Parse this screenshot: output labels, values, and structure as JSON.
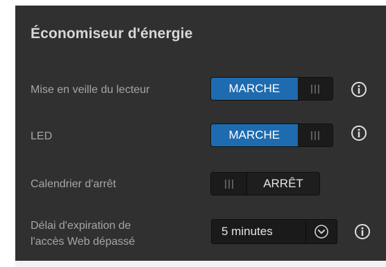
{
  "section": {
    "title": "Économiseur d'énergie"
  },
  "settings": [
    {
      "label": "Mise en veille du lecteur",
      "state_text": "MARCHE",
      "on": true
    },
    {
      "label": "LED",
      "state_text": "MARCHE",
      "on": true
    },
    {
      "label": "Calendrier d'arrêt",
      "state_text": "ARRÊT",
      "on": false
    },
    {
      "label_line1": "Délai d'expiration de",
      "label_line2": "l'accès Web dépassé",
      "selected_value": "5 minutes"
    }
  ],
  "icons": {
    "info": "info-icon",
    "toggle_grip": "grip-icon",
    "dropdown": "chevron-down-icon"
  },
  "colors": {
    "panel_bg": "#303030",
    "accent_on": "#1e6bb0",
    "label_text": "#a6a6a6",
    "title_text": "#d8d8d8"
  }
}
